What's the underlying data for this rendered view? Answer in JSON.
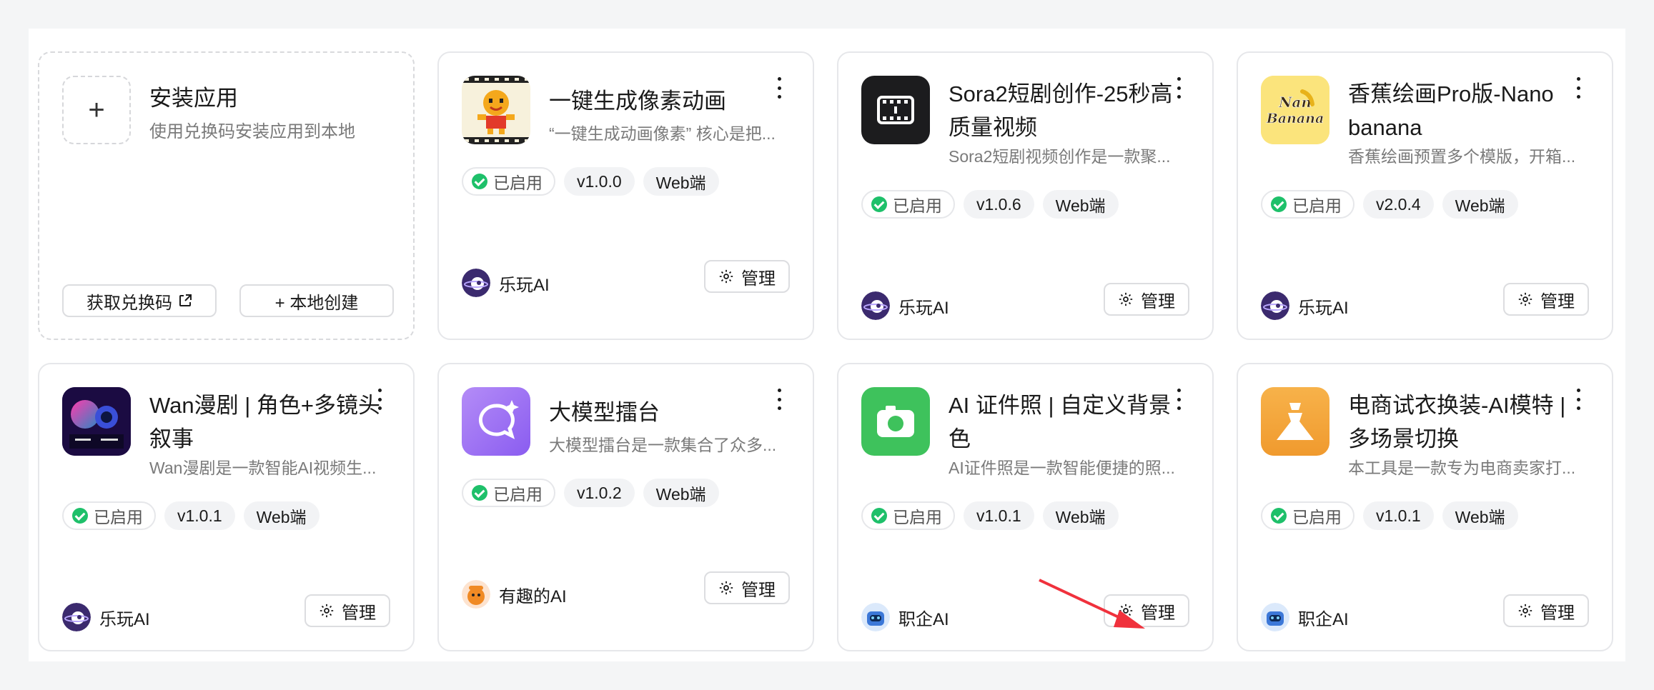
{
  "install": {
    "title": "安装应用",
    "desc": "使用兑换码安装应用到本地",
    "plus": "+",
    "get_code": "获取兑换码",
    "local_create": "+ 本地创建"
  },
  "common": {
    "status": "已启用",
    "platform": "Web端",
    "manage": "管理"
  },
  "apps": [
    {
      "title": "一键生成像素动画",
      "desc": "“一键生成动画像素” 核心是把...",
      "version": "v1.0.0",
      "author": "乐玩AI",
      "icon": "pixel-character-icon"
    },
    {
      "title": "Sora2短剧创作-25秒高质量视频",
      "desc": "Sora2短剧视频创作是一款聚...",
      "version": "v1.0.6",
      "author": "乐玩AI",
      "icon": "film-icon"
    },
    {
      "title": "香蕉绘画Pro版-Nano banana",
      "desc": "香蕉绘画预置多个模版，开箱...",
      "version": "v2.0.4",
      "author": "乐玩AI",
      "icon": "nano-banana-logo"
    },
    {
      "title": "Wan漫剧 | 角色+多镜头叙事",
      "desc": "Wan漫剧是一款智能AI视频生...",
      "version": "v1.0.1",
      "author": "乐玩AI",
      "icon": "wan-comic-icon"
    },
    {
      "title": "大模型擂台",
      "desc": "大模型擂台是一款集合了众多...",
      "version": "v1.0.2",
      "author": "有趣的AI",
      "icon": "chat-sparkle-icon"
    },
    {
      "title": "AI 证件照 | 自定义背景色",
      "desc": "AI证件照是一款智能便捷的照...",
      "version": "v1.0.1",
      "author": "职企AI",
      "icon": "camera-icon"
    },
    {
      "title": "电商试衣换装-AI模特 | 多场景切换",
      "desc": "本工具是一款专为电商卖家打...",
      "version": "v1.0.1",
      "author": "职企AI",
      "icon": "dress-icon"
    }
  ],
  "colors": {
    "status_green": "#1ec06a",
    "annotation_arrow": "#f0313c"
  }
}
